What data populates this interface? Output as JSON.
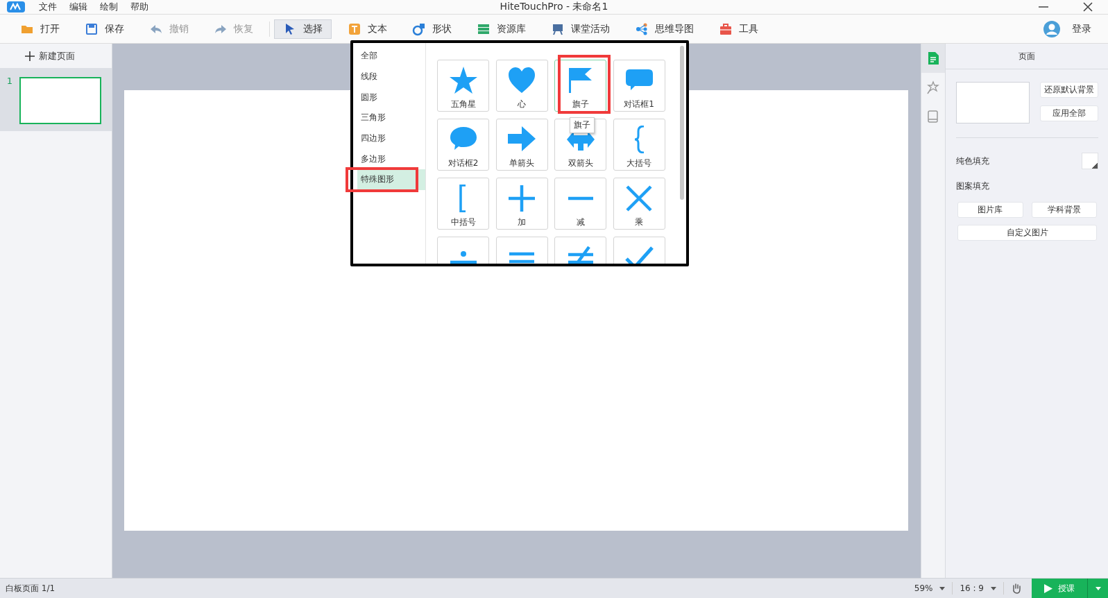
{
  "title_bar": {
    "menu": [
      "文件",
      "编辑",
      "绘制",
      "帮助"
    ],
    "title": "HiteTouchPro - 未命名1"
  },
  "toolbar": {
    "items": [
      {
        "kind": "open",
        "label": "打开",
        "disabled": false,
        "selected": false
      },
      {
        "kind": "save",
        "label": "保存",
        "disabled": false,
        "selected": false
      },
      {
        "kind": "undo",
        "label": "撤销",
        "disabled": true,
        "selected": false
      },
      {
        "kind": "redo",
        "label": "恢复",
        "disabled": true,
        "selected": false
      },
      {
        "kind": "select",
        "label": "选择",
        "disabled": false,
        "selected": true
      },
      {
        "kind": "text",
        "label": "文本",
        "disabled": false,
        "selected": false
      },
      {
        "kind": "shape",
        "label": "形状",
        "disabled": false,
        "selected": false
      },
      {
        "kind": "library",
        "label": "资源库",
        "disabled": false,
        "selected": false
      },
      {
        "kind": "activity",
        "label": "课堂活动",
        "disabled": false,
        "selected": false
      },
      {
        "kind": "mindmap",
        "label": "思维导图",
        "disabled": false,
        "selected": false
      },
      {
        "kind": "tools",
        "label": "工具",
        "disabled": false,
        "selected": false
      }
    ],
    "login": "登录"
  },
  "pages_panel": {
    "new_page": "新建页面",
    "pages": [
      {
        "number": "1",
        "selected": true
      }
    ]
  },
  "shape_picker": {
    "categories": [
      {
        "label": "全部",
        "selected": false,
        "highlighted": false
      },
      {
        "label": "线段",
        "selected": false,
        "highlighted": false
      },
      {
        "label": "圆形",
        "selected": false,
        "highlighted": false
      },
      {
        "label": "三角形",
        "selected": false,
        "highlighted": false
      },
      {
        "label": "四边形",
        "selected": false,
        "highlighted": false
      },
      {
        "label": "多边形",
        "selected": false,
        "highlighted": false
      },
      {
        "label": "特殊图形",
        "selected": true,
        "highlighted": true
      }
    ],
    "shapes": [
      {
        "kind": "star",
        "label": "五角星",
        "selected": false,
        "highlighted": false
      },
      {
        "kind": "heart",
        "label": "心",
        "selected": false,
        "highlighted": false
      },
      {
        "kind": "flag",
        "label": "旗子",
        "selected": true,
        "highlighted": true
      },
      {
        "kind": "callout-rect",
        "label": "对话框1",
        "selected": false,
        "highlighted": false
      },
      {
        "kind": "callout-round",
        "label": "对话框2",
        "selected": false,
        "highlighted": false
      },
      {
        "kind": "arrow",
        "label": "单箭头",
        "selected": false,
        "highlighted": false
      },
      {
        "kind": "double-arrow",
        "label": "双箭头",
        "selected": false,
        "highlighted": false
      },
      {
        "kind": "brace",
        "label": "大括号",
        "selected": false,
        "highlighted": false
      },
      {
        "kind": "bracket",
        "label": "中括号",
        "selected": false,
        "highlighted": false
      },
      {
        "kind": "plus",
        "label": "加",
        "selected": false,
        "highlighted": false
      },
      {
        "kind": "minus",
        "label": "减",
        "selected": false,
        "highlighted": false
      },
      {
        "kind": "times",
        "label": "乘",
        "selected": false,
        "highlighted": false
      },
      {
        "kind": "divide",
        "selected": false,
        "highlighted": false
      },
      {
        "kind": "equals",
        "selected": false,
        "highlighted": false
      },
      {
        "kind": "not-equal",
        "selected": false,
        "highlighted": false
      },
      {
        "kind": "check",
        "selected": false,
        "highlighted": false
      }
    ],
    "tooltip": "旗子"
  },
  "side_tabs": [
    {
      "kind": "page",
      "selected": true
    },
    {
      "kind": "effect",
      "selected": false
    },
    {
      "kind": "book",
      "selected": false
    }
  ],
  "properties": {
    "title": "页面",
    "background_buttons": [
      "还原默认背景",
      "应用全部"
    ],
    "solid_fill": "纯色填充",
    "pattern_fill": "图案填充",
    "pattern_buttons": [
      "图片库",
      "学科背景"
    ],
    "custom_button": "自定义图片"
  },
  "status_bar": {
    "page_info": "白板页面 1/1",
    "zoom": "59%",
    "ratio": "16 : 9",
    "start": "授课"
  }
}
